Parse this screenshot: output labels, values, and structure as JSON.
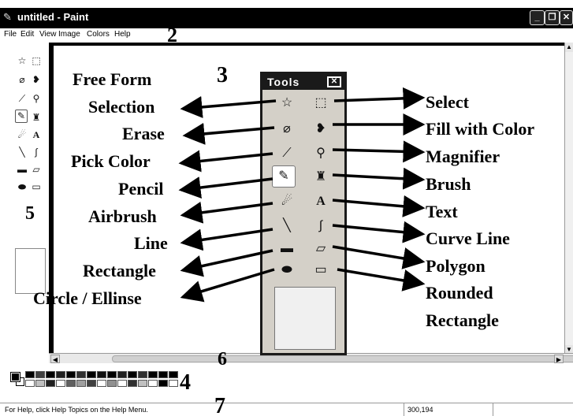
{
  "window": {
    "title": "untitled - Paint",
    "icon": "paint-app-icon",
    "controls": [
      "_",
      "❐",
      "✕"
    ]
  },
  "menu": [
    "File",
    "Edit",
    "View",
    "Image",
    "Colors",
    "Help"
  ],
  "callouts": {
    "n2": "2",
    "n3": "3",
    "n4": "4",
    "n5": "5",
    "n6": "6",
    "n7": "7"
  },
  "tools_palette": {
    "title": "Tools",
    "close": "✕"
  },
  "labels": {
    "left": [
      "Free Form",
      "Selection",
      "Erase",
      "Pick Color",
      "Pencil",
      "Airbrush",
      "Line",
      "Rectangle",
      "Circle / Ellinse"
    ],
    "right": [
      "Select",
      "Fill with Color",
      "Magnifier",
      "Brush",
      "Text",
      "Curve Line",
      "Polygon",
      "Rounded",
      "Rectangle"
    ]
  },
  "status": {
    "help_text": "For Help, click Help Topics on the Help Menu.",
    "coords": "300,194"
  },
  "colors": {
    "title_bar": "#000000",
    "palette_bg": "#d4d0c8",
    "swatches_top": [
      "#000000",
      "#404040",
      "#000000",
      "#202020",
      "#000000",
      "#303030",
      "#000000",
      "#101010",
      "#000000",
      "#202020",
      "#000000",
      "#303030",
      "#000000",
      "#000000",
      "#000000"
    ],
    "swatches_bottom": [
      "#ffffff",
      "#c0c0c0",
      "#202020",
      "#ffffff",
      "#606060",
      "#a0a0a0",
      "#404040",
      "#ffffff",
      "#909090",
      "#ffffff",
      "#303030",
      "#c0c0c0",
      "#ffffff",
      "#000000",
      "#ffffff"
    ]
  }
}
